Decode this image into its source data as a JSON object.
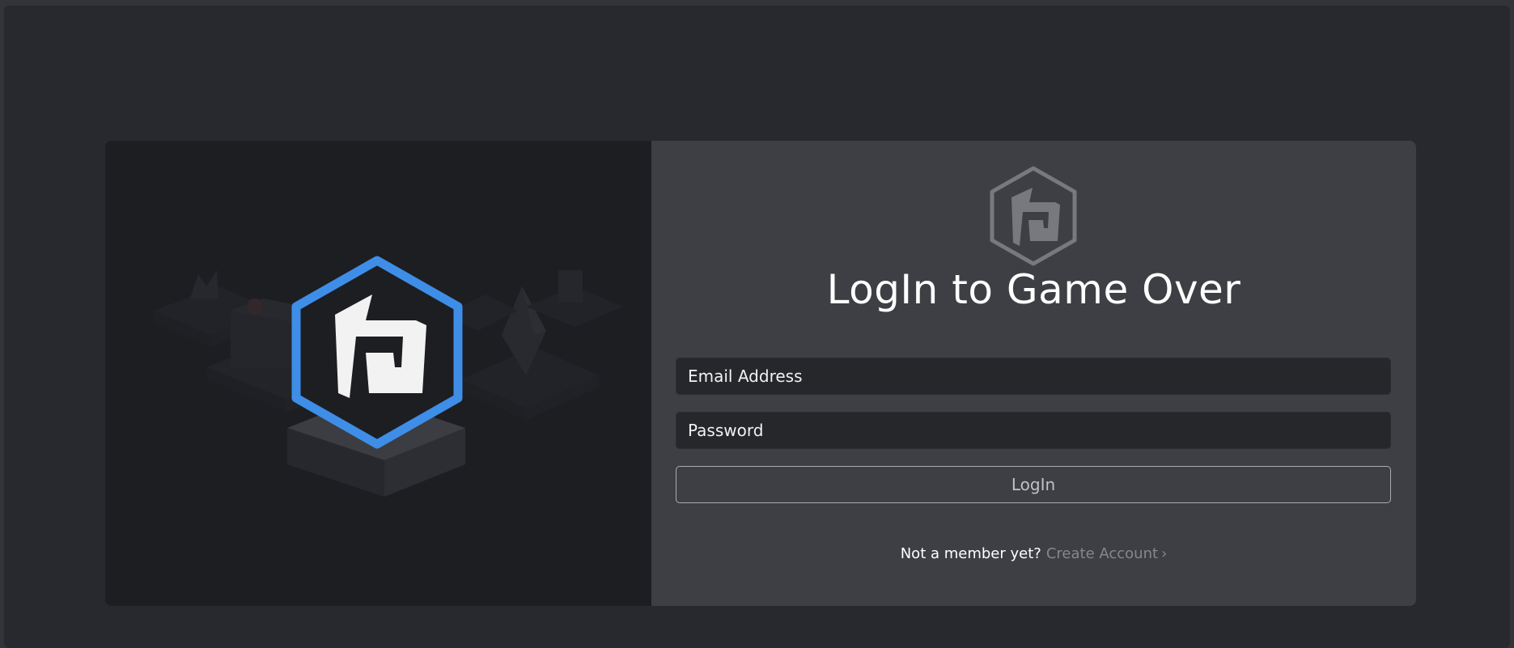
{
  "page": {
    "title": "LogIn to Game Over"
  },
  "form": {
    "email_placeholder": "Email Address",
    "email_value": "",
    "password_placeholder": "Password",
    "password_value": "",
    "login_label": "LogIn"
  },
  "signup": {
    "question": "Not a member yet?",
    "link_label": "Create Account",
    "chevron": "›"
  },
  "icons": {
    "hero": "game-over-hex-logo-icon",
    "brand": "game-over-hex-logo-icon",
    "chevron": "chevron-right-icon"
  },
  "colors": {
    "accent": "#3e8ee8",
    "page_bg": "#27292e",
    "left_panel": "#1d1e22",
    "right_panel": "#3d3f44",
    "input_bg": "#25272b"
  }
}
